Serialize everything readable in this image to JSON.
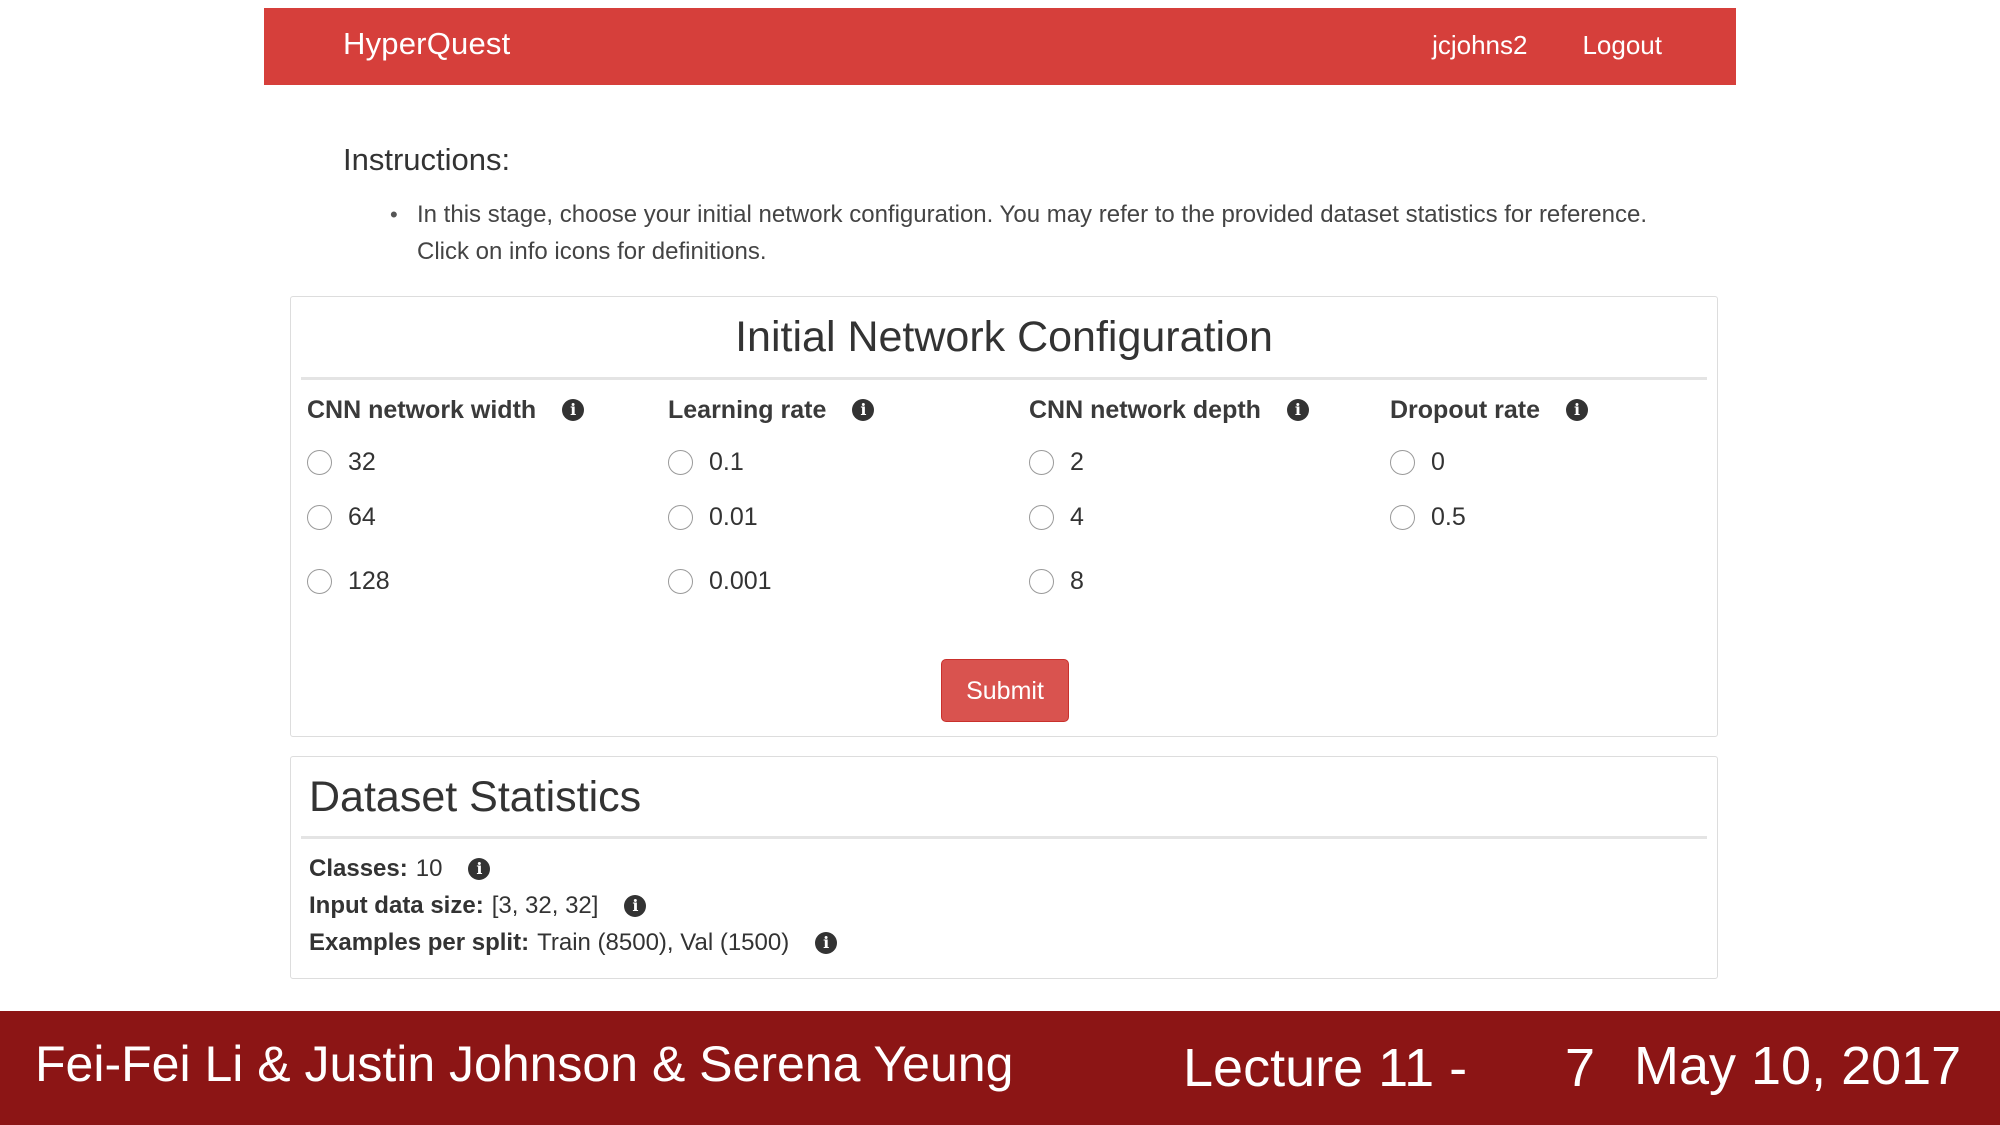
{
  "navbar": {
    "brand": "HyperQuest",
    "username": "jcjohns2",
    "logout": "Logout",
    "color": "#d63f3b"
  },
  "instructions": {
    "title": "Instructions:",
    "items": [
      "In this stage, choose your initial network configuration. You may refer to the provided dataset statistics for reference. Click on info icons for definitions."
    ]
  },
  "config": {
    "title": "Initial Network Configuration",
    "columns": [
      {
        "label": "CNN network width",
        "icon": "info-icon",
        "options": [
          "32",
          "64",
          "128"
        ]
      },
      {
        "label": "Learning rate",
        "icon": "info-icon",
        "options": [
          "0.1",
          "0.01",
          "0.001"
        ]
      },
      {
        "label": "CNN network depth",
        "icon": "info-icon",
        "options": [
          "2",
          "4",
          "8"
        ]
      },
      {
        "label": "Dropout rate",
        "icon": "info-icon",
        "options": [
          "0",
          "0.5"
        ]
      }
    ],
    "submit_label": "Submit",
    "submit_color": "#d9534f"
  },
  "stats": {
    "title": "Dataset Statistics",
    "rows": [
      {
        "label": "Classes:",
        "value": "10"
      },
      {
        "label": "Input data size:",
        "value": "[3, 32, 32]"
      },
      {
        "label": "Examples per split:",
        "value": "Train (8500), Val (1500)"
      }
    ]
  },
  "footer": {
    "authors": "Fei-Fei Li & Justin Johnson & Serena Yeung",
    "lecture": "Lecture 11 -",
    "page": "7",
    "date": "May 10, 2017",
    "color": "#8c1515"
  }
}
